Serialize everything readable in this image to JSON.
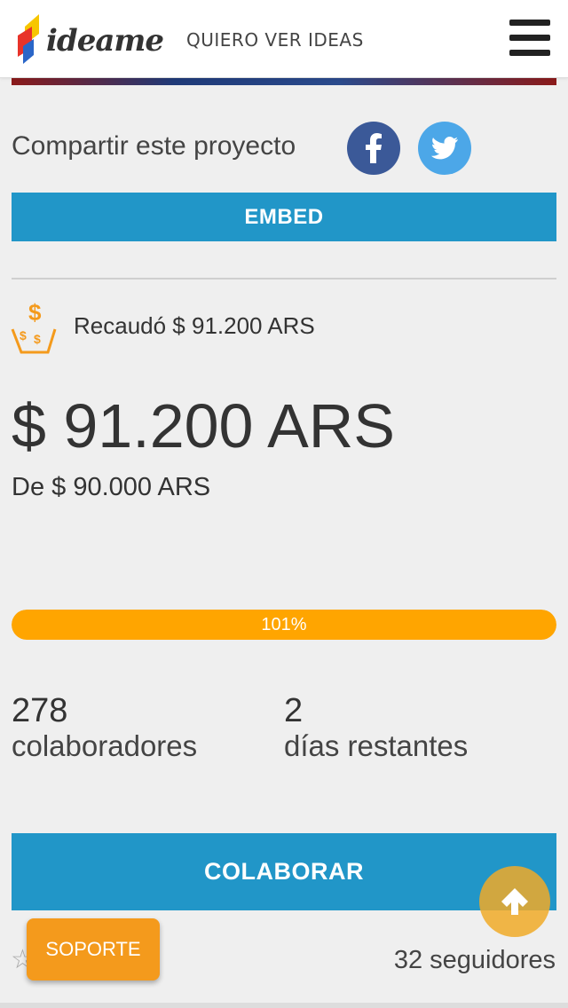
{
  "header": {
    "logo_text": "ideame",
    "nav_link": "QUIERO VER IDEAS"
  },
  "share": {
    "label": "Compartir este proyecto",
    "facebook_color": "#3b5998",
    "twitter_color": "#4ca7e8"
  },
  "embed": {
    "label": "EMBED"
  },
  "funding": {
    "raised_label": "Recaudó $ 91.200 ARS",
    "amount": "$ 91.200 ARS",
    "goal": "De $ 90.000 ARS",
    "progress_text": "101%",
    "progress_percent": 101
  },
  "stats": {
    "backers_count": "278",
    "backers_label": "colaboradores",
    "days_count": "2",
    "days_label": "días restantes"
  },
  "actions": {
    "colaborar_label": "COLABORAR",
    "soporte_label": "SOPORTE",
    "followers": "32 seguidores"
  },
  "colors": {
    "accent_blue": "#2196c8",
    "progress_orange": "#ffa500",
    "support_orange": "#f49a1c"
  }
}
